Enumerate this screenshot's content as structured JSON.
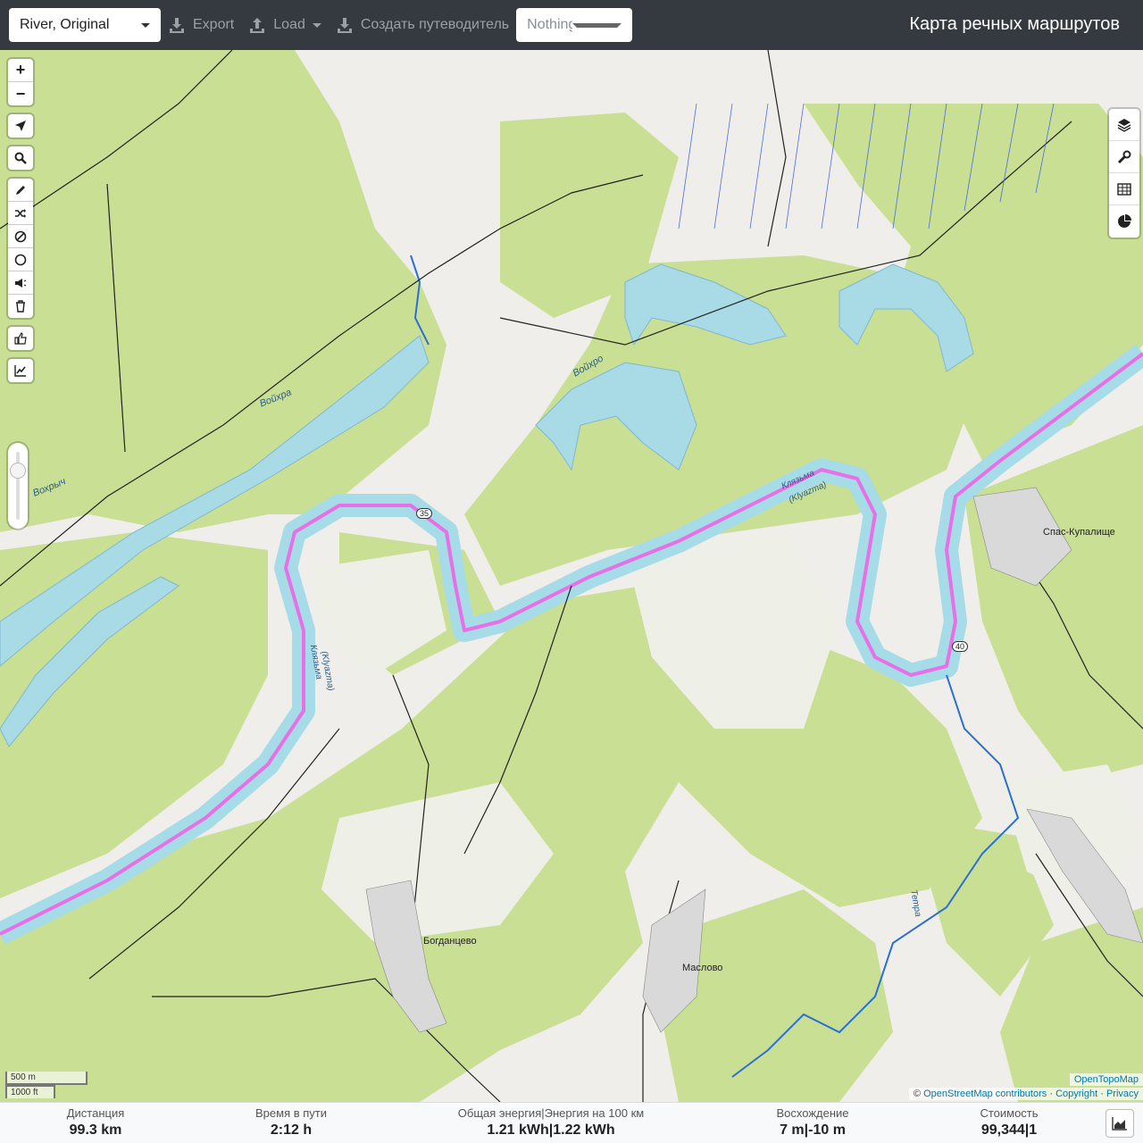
{
  "navbar": {
    "profile_select": "River, Original",
    "export_label": "Export",
    "load_label": "Load",
    "guide_label": "Создать путеводитель",
    "nothing_selected": "Nothing selected",
    "title": "Карта речных маршрутов"
  },
  "map": {
    "controls_left": [
      "zoom-in",
      "zoom-out",
      "locate",
      "search",
      "draw",
      "reverse",
      "no-go",
      "circle",
      "poi",
      "delete",
      "thumb",
      "elevation"
    ],
    "zoom_in": "+",
    "zoom_out": "−",
    "labels": {
      "voykhra": "Войхра",
      "voykhro": "Войхро",
      "vokhrych": "Вохрыч",
      "klyazma_1": "Клязьма",
      "klyazma_1b": "(Klyazma)",
      "klyazma_2": "Клязьма",
      "klyazma_2b": "(Klyazma)",
      "spas": "Спас-Купалище",
      "bogdantsevo": "Богданцево",
      "maslovo": "Маслово",
      "road_35": "35",
      "road_40": "40",
      "tetra": "Тетра"
    },
    "scale_m": "500 m",
    "scale_ft": "1000 ft",
    "attribution_top": "OpenTopoMap",
    "attribution_prefix": "©",
    "attribution_osm": "OpenStreetMap contributors",
    "attribution_sep1": "·",
    "attribution_copyright": "Copyright",
    "attribution_sep2": "·",
    "attribution_privacy": "Privacy",
    "colors": {
      "forest": "#c8df90",
      "water": "#a6dbe8",
      "route": "#e96fe7",
      "river": "#2a6fd1"
    }
  },
  "stats": {
    "distance_label": "Дистанция",
    "distance_value": "99.3 km",
    "time_label": "Время в пути",
    "time_value": "2:12 h",
    "energy_label": "Общая энергия|Энергия на 100 км",
    "energy_value": "1.21 kWh|1.22 kWh",
    "ascent_label": "Восхождение",
    "ascent_value": "7 m|-10 m",
    "cost_label": "Стоимость",
    "cost_value": "99,344|1"
  }
}
